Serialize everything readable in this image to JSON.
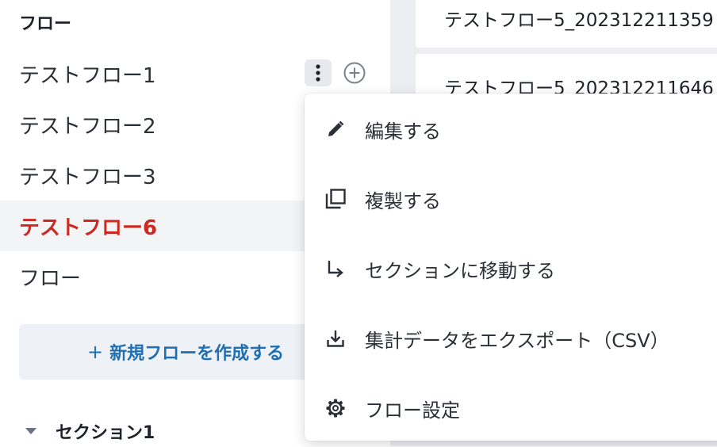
{
  "sidebar": {
    "heading": "フロー",
    "items": [
      {
        "label": "テストフロー1"
      },
      {
        "label": "テストフロー2"
      },
      {
        "label": "テストフロー3"
      },
      {
        "label": "テストフロー6"
      },
      {
        "label": "フロー"
      }
    ],
    "active_index": 3,
    "new_flow_button": {
      "icon": "+",
      "label": "新規フローを作成する"
    },
    "section": {
      "label": "セクション1"
    }
  },
  "row_actions": {
    "more_icon": "kebab-vertical-icon",
    "add_icon": "plus-circle-icon"
  },
  "right_pane": {
    "cards": [
      {
        "title": "テストフロー5_202312211359"
      },
      {
        "title": "テストフロー5_202312211646"
      }
    ]
  },
  "context_menu": {
    "items": [
      {
        "label": "編集する",
        "icon": "pencil-icon"
      },
      {
        "label": "複製する",
        "icon": "copy-icon"
      },
      {
        "label": "セクションに移動する",
        "icon": "arrow-turn-down-right-icon"
      },
      {
        "label": "集計データをエクスポート（CSV）",
        "icon": "download-icon"
      },
      {
        "label": "フロー設定",
        "icon": "gear-icon"
      }
    ]
  },
  "colors": {
    "active_text": "#cc2a20",
    "link_blue": "#1f6fb2",
    "pane_bg": "#eceef2"
  }
}
